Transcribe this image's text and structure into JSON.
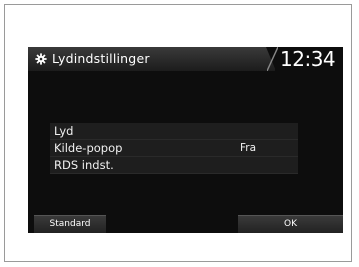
{
  "screen": {
    "title": "Lydindstillinger",
    "clock": "12:34",
    "header_icon": "gear-icon"
  },
  "menu": {
    "items": [
      {
        "label": "Lyd",
        "value": ""
      },
      {
        "label": "Kilde-popop",
        "value": "Fra"
      },
      {
        "label": "RDS indst.",
        "value": ""
      }
    ]
  },
  "footer": {
    "standard_label": "Standard",
    "ok_label": "OK"
  },
  "colors": {
    "screen_background": "#0d0d0d",
    "text": "#ffffff",
    "row_background": "#1e1e1e"
  }
}
